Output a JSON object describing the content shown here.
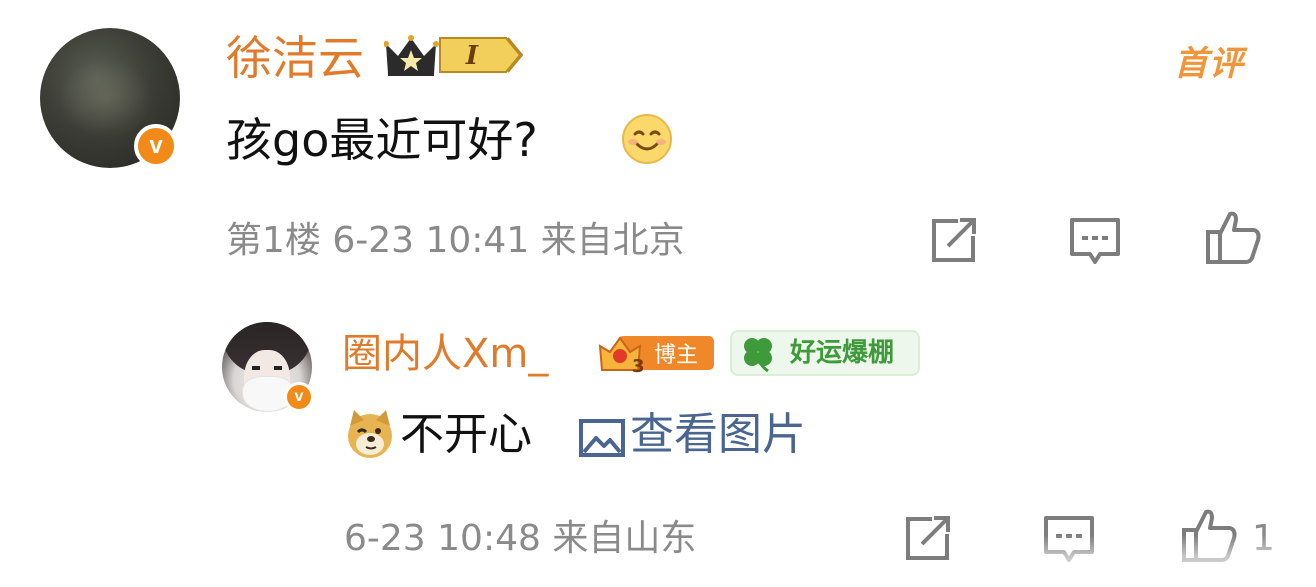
{
  "comment": {
    "author": "徐洁云",
    "fan_level": "I",
    "tag": "首评",
    "text": "孩go最近可好?",
    "meta": "第1楼 6-23 10:41 来自北京",
    "verified_mark": "v",
    "emoji": "smile-icon"
  },
  "reply": {
    "author": "圈内人Xm_",
    "badge_label": "博主",
    "luck_label": "好运爆棚",
    "text": "不开心",
    "image_link": "查看图片",
    "meta": "6-23 10:48 来自山东",
    "like_count": "1",
    "verified_mark": "v",
    "emoji": "doge-icon"
  },
  "colors": {
    "username": "#e07b2c",
    "meta": "#8a8a8a",
    "link": "#4a6690",
    "verified": "#f28a1a",
    "luck": "#3e9a3a"
  }
}
